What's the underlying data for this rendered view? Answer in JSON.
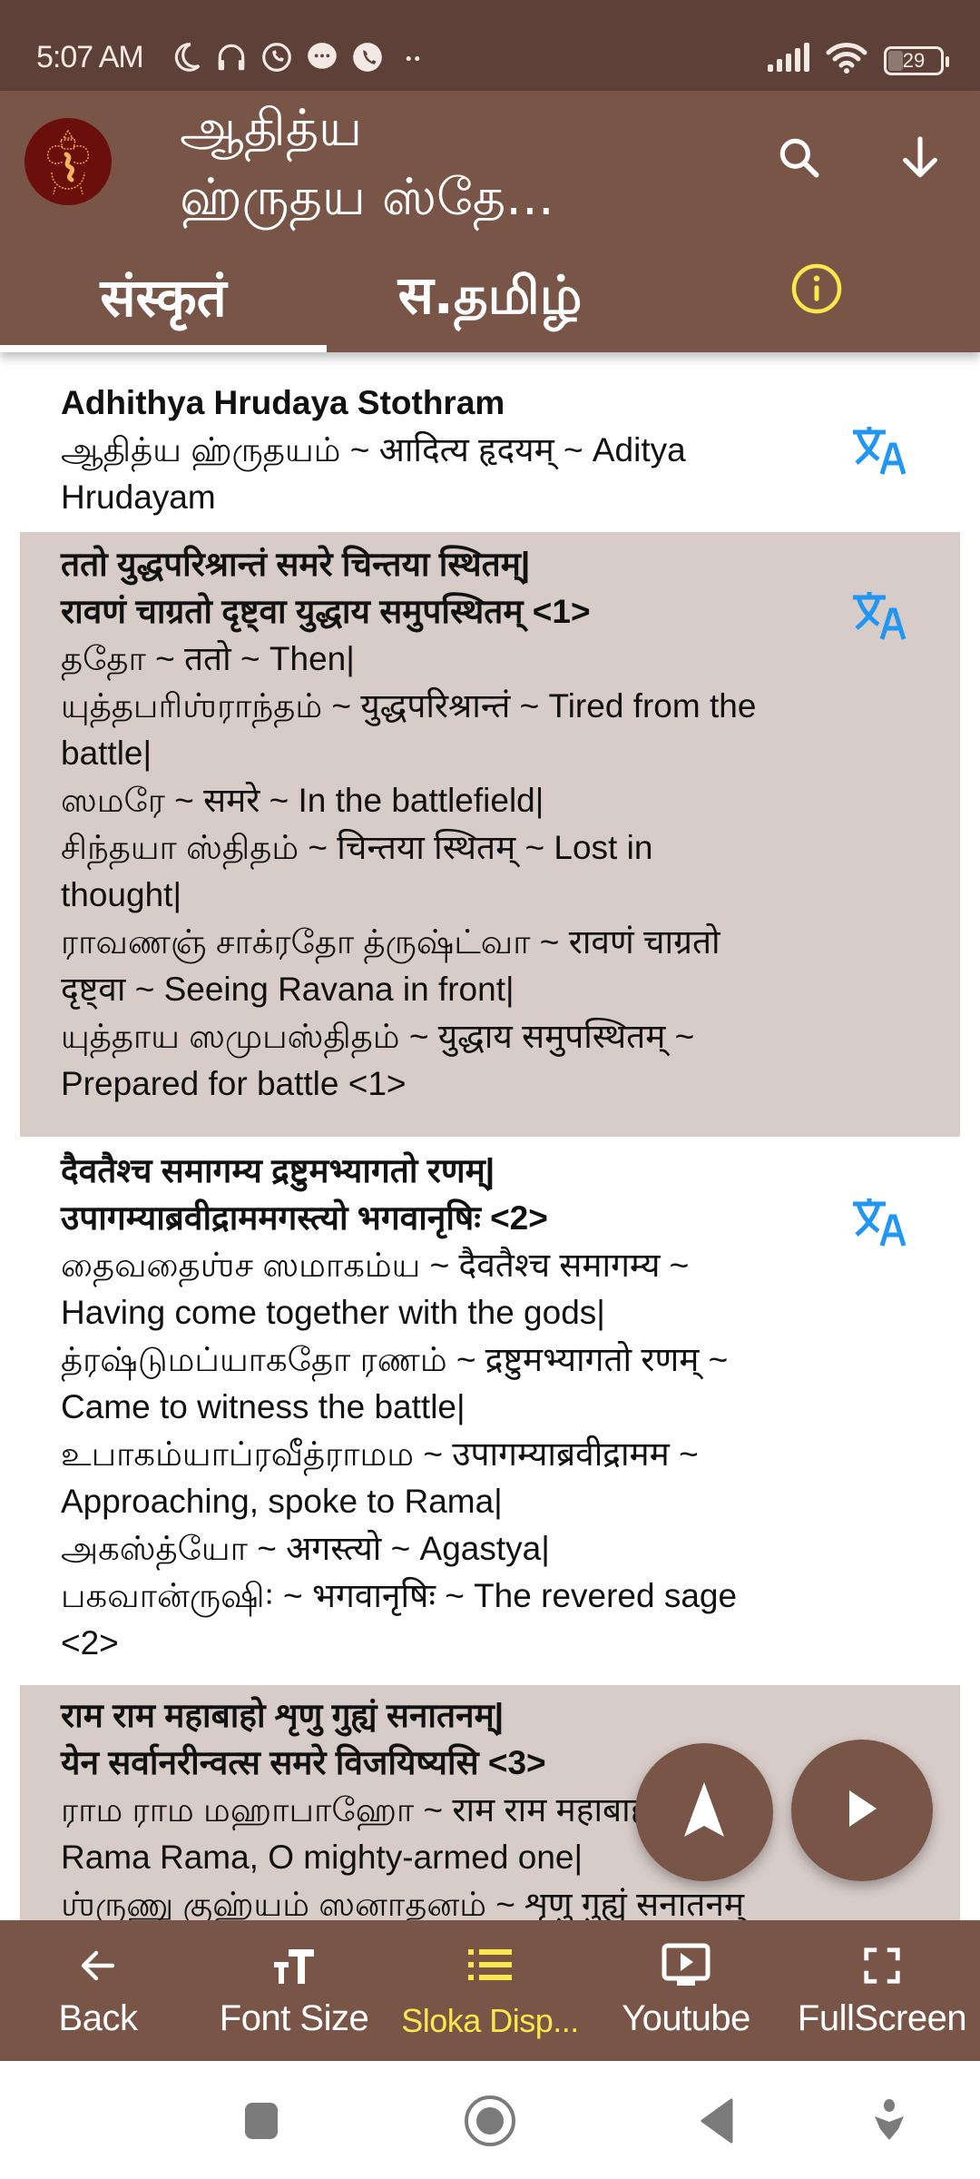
{
  "status_bar": {
    "time": "5:07 AM",
    "left_icons": [
      "moon-icon",
      "headphones-icon",
      "whatsapp-icon",
      "chat-bubble-icon",
      "phone-icon",
      "more-dots-icon"
    ],
    "right_icons": [
      "signal-icon",
      "wifi-icon",
      "battery-icon"
    ],
    "battery_level": "29"
  },
  "app_bar": {
    "title_line1": "ஆதித்ய",
    "title_line2": "ஹ்ருதய ஸ்தே...",
    "logo": "ganesha-logo",
    "actions": [
      "search-icon",
      "arrow-down-icon"
    ]
  },
  "tabs": {
    "items": [
      {
        "label": "संस्कृतं",
        "selected": true
      },
      {
        "label": "स.தமிழ்",
        "selected": false
      }
    ],
    "info_icon": "info-icon",
    "info_color": "#fde74c"
  },
  "content": {
    "header": {
      "title": "Adhithya Hrudaya Stothram",
      "subtitle_line1": "ஆதித்ய ஹ்ருதயம் ~ आदित्य हृदयम् ~ Aditya",
      "subtitle_line2": "Hrudayam"
    },
    "slokas": [
      {
        "verse_lines": [
          "ततो युद्धपरिश्रान्तं समरे चिन्तया स्थितम्|",
          "रावणं चाग्रतो दृष्ट्वा युद्धाय समुपस्थितम् <1>"
        ],
        "meaning_lines": [
          "ததோ ~ ततो ~ Then|",
          "யுத்தபரிஶ்ராந்தம் ~ युद्धपरिश्रान्तं ~ Tired from the",
          "battle|",
          "ஸமரே ~ समरे ~ In the battlefield|",
          "சிந்தயா ஸ்திதம் ~ चिन्तया स्थितम् ~ Lost in",
          "thought|",
          "ராவணஞ் சாக்ரதோ த்ருஷ்ட்வா ~ रावणं चाग्रतो",
          "दृष्ट्वा ~ Seeing Ravana in front|",
          "யுத்தாய ஸமுபஸ்திதம் ~ युद्धाय समुपस्थितम् ~",
          "Prepared for battle <1>"
        ]
      },
      {
        "verse_lines": [
          "दैवतैश्च समागम्य द्रष्टुमभ्यागतो रणम्|",
          "उपागम्याब्रवीद्राममगस्त्यो भगवानृषिः <2>"
        ],
        "meaning_lines": [
          "தைவதைஶ்ச ஸமாகம்ய ~ दैवतैश्च समागम्य ~",
          "Having come together with the gods|",
          "த்ரஷ்டுமப்யாகதோ ரணம் ~ द्रष्टुमभ्यागतो रणम् ~",
          "Came to witness the battle|",
          "உபாகம்யாப்ரவீத்ராமம ~ उपागम्याब्रवीद्रामम ~",
          "Approaching, spoke to Rama|",
          "அகஸ்த்யோ ~ अगस्त्यो ~ Agastya|",
          "பகவான்ருஷி꞉ ~ भगवानृषिः ~ The revered sage",
          "<2>"
        ]
      },
      {
        "verse_lines": [
          "राम राम महाबाहो शृणु गुह्यं सनातनम्|",
          "येन सर्वानरीन्वत्स समरे विजयिष्यसि <3>"
        ],
        "meaning_lines": [
          "ராம ராம மஹாபாஹோ ~ राम राम महाबाहो",
          "Rama Rama, O mighty-armed one|",
          "ஶ்ருணு குஹ்யம் ஸனாதனம் ~ शृणु गुह्यं सनातनम्"
        ]
      }
    ],
    "translate_icon": "translate-icon",
    "translate_color": "#2196f3",
    "shaded_color": "#d7ccc8"
  },
  "fabs": {
    "scroll_up": "navigation-arrow-icon",
    "play": "play-icon"
  },
  "bottom_nav": {
    "items": [
      {
        "label": "Back",
        "icon": "arrow-back-icon",
        "active": false
      },
      {
        "label": "Font Size",
        "icon": "font-size-icon",
        "active": false
      },
      {
        "label": "Sloka Disp...",
        "icon": "list-icon",
        "active": true
      },
      {
        "label": "Youtube",
        "icon": "youtube-icon",
        "active": false
      },
      {
        "label": "FullScreen",
        "icon": "fullscreen-icon",
        "active": false
      }
    ],
    "active_color": "#fde74c"
  },
  "system_nav": {
    "buttons": [
      "recents-button",
      "home-button",
      "back-button",
      "assistant-button"
    ]
  },
  "colors": {
    "status_bar": "#5d4037",
    "app_bar": "#795548"
  }
}
